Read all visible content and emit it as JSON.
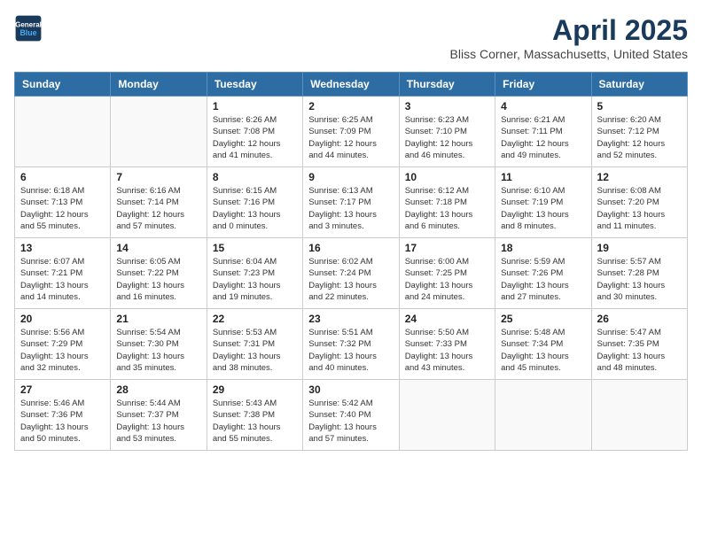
{
  "header": {
    "logo_line1": "General",
    "logo_line2": "Blue",
    "title": "April 2025",
    "subtitle": "Bliss Corner, Massachusetts, United States"
  },
  "weekdays": [
    "Sunday",
    "Monday",
    "Tuesday",
    "Wednesday",
    "Thursday",
    "Friday",
    "Saturday"
  ],
  "weeks": [
    [
      {
        "day": "",
        "info": ""
      },
      {
        "day": "",
        "info": ""
      },
      {
        "day": "1",
        "info": "Sunrise: 6:26 AM\nSunset: 7:08 PM\nDaylight: 12 hours\nand 41 minutes."
      },
      {
        "day": "2",
        "info": "Sunrise: 6:25 AM\nSunset: 7:09 PM\nDaylight: 12 hours\nand 44 minutes."
      },
      {
        "day": "3",
        "info": "Sunrise: 6:23 AM\nSunset: 7:10 PM\nDaylight: 12 hours\nand 46 minutes."
      },
      {
        "day": "4",
        "info": "Sunrise: 6:21 AM\nSunset: 7:11 PM\nDaylight: 12 hours\nand 49 minutes."
      },
      {
        "day": "5",
        "info": "Sunrise: 6:20 AM\nSunset: 7:12 PM\nDaylight: 12 hours\nand 52 minutes."
      }
    ],
    [
      {
        "day": "6",
        "info": "Sunrise: 6:18 AM\nSunset: 7:13 PM\nDaylight: 12 hours\nand 55 minutes."
      },
      {
        "day": "7",
        "info": "Sunrise: 6:16 AM\nSunset: 7:14 PM\nDaylight: 12 hours\nand 57 minutes."
      },
      {
        "day": "8",
        "info": "Sunrise: 6:15 AM\nSunset: 7:16 PM\nDaylight: 13 hours\nand 0 minutes."
      },
      {
        "day": "9",
        "info": "Sunrise: 6:13 AM\nSunset: 7:17 PM\nDaylight: 13 hours\nand 3 minutes."
      },
      {
        "day": "10",
        "info": "Sunrise: 6:12 AM\nSunset: 7:18 PM\nDaylight: 13 hours\nand 6 minutes."
      },
      {
        "day": "11",
        "info": "Sunrise: 6:10 AM\nSunset: 7:19 PM\nDaylight: 13 hours\nand 8 minutes."
      },
      {
        "day": "12",
        "info": "Sunrise: 6:08 AM\nSunset: 7:20 PM\nDaylight: 13 hours\nand 11 minutes."
      }
    ],
    [
      {
        "day": "13",
        "info": "Sunrise: 6:07 AM\nSunset: 7:21 PM\nDaylight: 13 hours\nand 14 minutes."
      },
      {
        "day": "14",
        "info": "Sunrise: 6:05 AM\nSunset: 7:22 PM\nDaylight: 13 hours\nand 16 minutes."
      },
      {
        "day": "15",
        "info": "Sunrise: 6:04 AM\nSunset: 7:23 PM\nDaylight: 13 hours\nand 19 minutes."
      },
      {
        "day": "16",
        "info": "Sunrise: 6:02 AM\nSunset: 7:24 PM\nDaylight: 13 hours\nand 22 minutes."
      },
      {
        "day": "17",
        "info": "Sunrise: 6:00 AM\nSunset: 7:25 PM\nDaylight: 13 hours\nand 24 minutes."
      },
      {
        "day": "18",
        "info": "Sunrise: 5:59 AM\nSunset: 7:26 PM\nDaylight: 13 hours\nand 27 minutes."
      },
      {
        "day": "19",
        "info": "Sunrise: 5:57 AM\nSunset: 7:28 PM\nDaylight: 13 hours\nand 30 minutes."
      }
    ],
    [
      {
        "day": "20",
        "info": "Sunrise: 5:56 AM\nSunset: 7:29 PM\nDaylight: 13 hours\nand 32 minutes."
      },
      {
        "day": "21",
        "info": "Sunrise: 5:54 AM\nSunset: 7:30 PM\nDaylight: 13 hours\nand 35 minutes."
      },
      {
        "day": "22",
        "info": "Sunrise: 5:53 AM\nSunset: 7:31 PM\nDaylight: 13 hours\nand 38 minutes."
      },
      {
        "day": "23",
        "info": "Sunrise: 5:51 AM\nSunset: 7:32 PM\nDaylight: 13 hours\nand 40 minutes."
      },
      {
        "day": "24",
        "info": "Sunrise: 5:50 AM\nSunset: 7:33 PM\nDaylight: 13 hours\nand 43 minutes."
      },
      {
        "day": "25",
        "info": "Sunrise: 5:48 AM\nSunset: 7:34 PM\nDaylight: 13 hours\nand 45 minutes."
      },
      {
        "day": "26",
        "info": "Sunrise: 5:47 AM\nSunset: 7:35 PM\nDaylight: 13 hours\nand 48 minutes."
      }
    ],
    [
      {
        "day": "27",
        "info": "Sunrise: 5:46 AM\nSunset: 7:36 PM\nDaylight: 13 hours\nand 50 minutes."
      },
      {
        "day": "28",
        "info": "Sunrise: 5:44 AM\nSunset: 7:37 PM\nDaylight: 13 hours\nand 53 minutes."
      },
      {
        "day": "29",
        "info": "Sunrise: 5:43 AM\nSunset: 7:38 PM\nDaylight: 13 hours\nand 55 minutes."
      },
      {
        "day": "30",
        "info": "Sunrise: 5:42 AM\nSunset: 7:40 PM\nDaylight: 13 hours\nand 57 minutes."
      },
      {
        "day": "",
        "info": ""
      },
      {
        "day": "",
        "info": ""
      },
      {
        "day": "",
        "info": ""
      }
    ]
  ]
}
